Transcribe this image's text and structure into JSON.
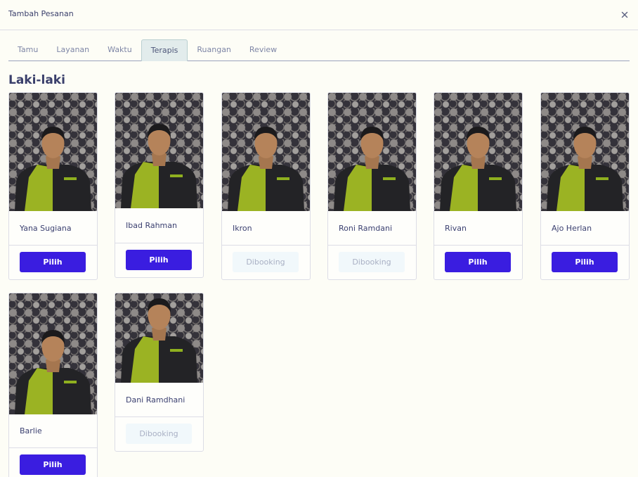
{
  "modal": {
    "title": "Tambah Pesanan",
    "close_icon": "close-icon"
  },
  "tabs": [
    {
      "label": "Tamu"
    },
    {
      "label": "Layanan"
    },
    {
      "label": "Waktu"
    },
    {
      "label": "Terapis",
      "active": true
    },
    {
      "label": "Ruangan"
    },
    {
      "label": "Review"
    }
  ],
  "section": {
    "title": "Laki-laki"
  },
  "therapists": [
    {
      "name": "Yana Sugiana",
      "button": "Pilih",
      "status": "available"
    },
    {
      "name": "Ibad Rahman",
      "button": "Pilih",
      "status": "available"
    },
    {
      "name": "Ikron",
      "button": "Dibooking",
      "status": "booked"
    },
    {
      "name": "Roni Ramdani",
      "button": "Dibooking",
      "status": "booked"
    },
    {
      "name": "Rivan",
      "button": "Pilih",
      "status": "available"
    },
    {
      "name": "Ajo Herlan",
      "button": "Pilih",
      "status": "available"
    },
    {
      "name": "Barlie",
      "button": "Pilih",
      "status": "available"
    },
    {
      "name": "Dani Ramdhani",
      "button": "Dibooking",
      "status": "booked"
    }
  ],
  "colors": {
    "primary_button": "#3a1de0",
    "booked_button": "#f1f8fb",
    "active_tab": "#e2ecec",
    "background": "#fdfdf6"
  }
}
